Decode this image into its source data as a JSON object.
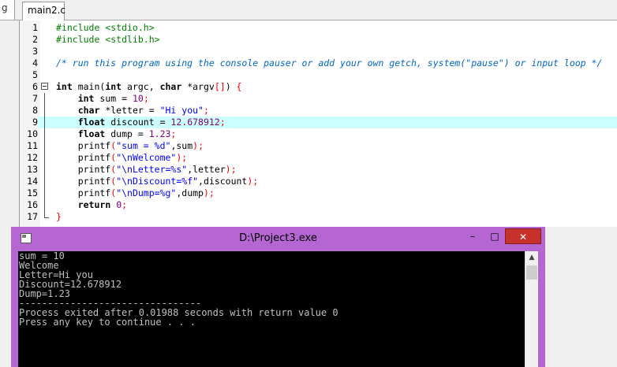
{
  "editor": {
    "side_stub": "g",
    "active_tab": "main2.c",
    "highlight_color": "#ccffff",
    "lines": [
      {
        "n": "1",
        "tokens": [
          {
            "t": "#include <stdio.h>",
            "c": "pp"
          }
        ]
      },
      {
        "n": "2",
        "tokens": [
          {
            "t": "#include <stdlib.h>",
            "c": "pp"
          }
        ]
      },
      {
        "n": "3",
        "tokens": []
      },
      {
        "n": "4",
        "tokens": [
          {
            "t": "/* run this program using the console pauser or add your own getch, system(\"pause\") or input loop */",
            "c": "cm"
          }
        ]
      },
      {
        "n": "5",
        "tokens": []
      },
      {
        "n": "6",
        "fold": "start",
        "tokens": [
          {
            "t": "int",
            "c": "kw"
          },
          {
            "t": " main(",
            "c": "tx"
          },
          {
            "t": "int",
            "c": "kw"
          },
          {
            "t": " argc, ",
            "c": "tx"
          },
          {
            "t": "char",
            "c": "kw"
          },
          {
            "t": " *argv",
            "c": "tx"
          },
          {
            "t": "[]",
            "c": "sym"
          },
          {
            "t": ") ",
            "c": "tx"
          },
          {
            "t": "{",
            "c": "sym"
          }
        ]
      },
      {
        "n": "7",
        "fold": "mid",
        "tokens": [
          {
            "t": "    ",
            "c": "tx"
          },
          {
            "t": "int",
            "c": "kw"
          },
          {
            "t": " sum = ",
            "c": "tx"
          },
          {
            "t": "10",
            "c": "num"
          },
          {
            "t": ";",
            "c": "sym"
          }
        ]
      },
      {
        "n": "8",
        "fold": "mid",
        "tokens": [
          {
            "t": "    ",
            "c": "tx"
          },
          {
            "t": "char",
            "c": "kw"
          },
          {
            "t": " *letter = ",
            "c": "tx"
          },
          {
            "t": "\"Hi you\"",
            "c": "str"
          },
          {
            "t": ";",
            "c": "sym"
          }
        ]
      },
      {
        "n": "9",
        "fold": "mid",
        "highlight": true,
        "tokens": [
          {
            "t": "    ",
            "c": "tx"
          },
          {
            "t": "float",
            "c": "kw"
          },
          {
            "t": " discount = ",
            "c": "tx"
          },
          {
            "t": "12.678912",
            "c": "num"
          },
          {
            "t": ";",
            "c": "sym"
          }
        ]
      },
      {
        "n": "10",
        "fold": "mid",
        "tokens": [
          {
            "t": "    ",
            "c": "tx"
          },
          {
            "t": "float",
            "c": "kw"
          },
          {
            "t": " dump = ",
            "c": "tx"
          },
          {
            "t": "1.23",
            "c": "num"
          },
          {
            "t": ";",
            "c": "sym"
          }
        ]
      },
      {
        "n": "11",
        "fold": "mid",
        "tokens": [
          {
            "t": "    printf",
            "c": "tx"
          },
          {
            "t": "(",
            "c": "sym"
          },
          {
            "t": "\"sum = %d\"",
            "c": "str"
          },
          {
            "t": ",sum",
            "c": "tx"
          },
          {
            "t": ");",
            "c": "sym"
          }
        ]
      },
      {
        "n": "12",
        "fold": "mid",
        "tokens": [
          {
            "t": "    printf",
            "c": "tx"
          },
          {
            "t": "(",
            "c": "sym"
          },
          {
            "t": "\"\\nWelcome\"",
            "c": "str"
          },
          {
            "t": ");",
            "c": "sym"
          }
        ]
      },
      {
        "n": "13",
        "fold": "mid",
        "tokens": [
          {
            "t": "    printf",
            "c": "tx"
          },
          {
            "t": "(",
            "c": "sym"
          },
          {
            "t": "\"\\nLetter=%s\"",
            "c": "str"
          },
          {
            "t": ",letter",
            "c": "tx"
          },
          {
            "t": ");",
            "c": "sym"
          }
        ]
      },
      {
        "n": "14",
        "fold": "mid",
        "tokens": [
          {
            "t": "    printf",
            "c": "tx"
          },
          {
            "t": "(",
            "c": "sym"
          },
          {
            "t": "\"\\nDiscount=%f\"",
            "c": "str"
          },
          {
            "t": ",discount",
            "c": "tx"
          },
          {
            "t": ");",
            "c": "sym"
          }
        ]
      },
      {
        "n": "15",
        "fold": "mid",
        "tokens": [
          {
            "t": "    printf",
            "c": "tx"
          },
          {
            "t": "(",
            "c": "sym"
          },
          {
            "t": "\"\\nDump=%g\"",
            "c": "str"
          },
          {
            "t": ",dump",
            "c": "tx"
          },
          {
            "t": ");",
            "c": "sym"
          }
        ]
      },
      {
        "n": "16",
        "fold": "mid",
        "tokens": [
          {
            "t": "    ",
            "c": "tx"
          },
          {
            "t": "return",
            "c": "kw"
          },
          {
            "t": " ",
            "c": "tx"
          },
          {
            "t": "0",
            "c": "num"
          },
          {
            "t": ";",
            "c": "sym"
          }
        ]
      },
      {
        "n": "17",
        "fold": "end",
        "tokens": [
          {
            "t": "}",
            "c": "sym"
          }
        ]
      }
    ]
  },
  "console": {
    "title": "D:\\Project3.exe",
    "min_label": "–",
    "max_label": "□",
    "close_label": "✕",
    "scroll_up_label": "▲",
    "accent_color": "#b666d2",
    "close_color": "#c7312c",
    "output": [
      "sum = 10",
      "Welcome",
      "Letter=Hi you",
      "Discount=12.678912",
      "Dump=1.23",
      "--------------------------------",
      "Process exited after 0.01988 seconds with return value 0",
      "Press any key to continue . . ."
    ]
  }
}
